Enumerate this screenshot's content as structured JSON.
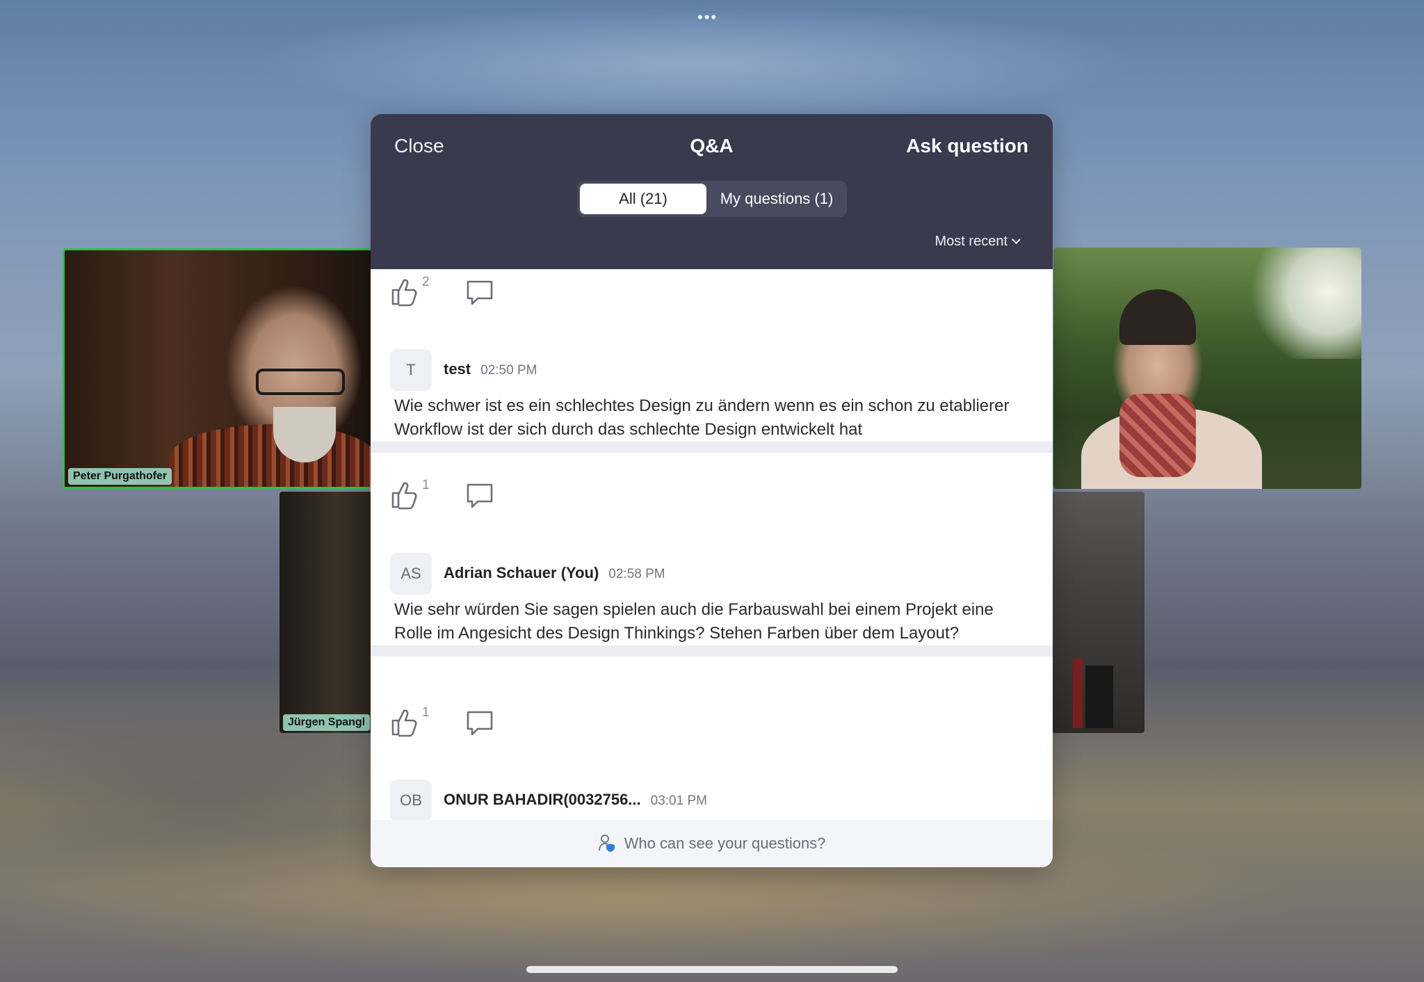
{
  "window": {
    "more_icon": "ellipsis-icon"
  },
  "participants": [
    {
      "name": "Peter Purgathofer",
      "speaking": true,
      "speaking_color": "#2fbf4a"
    },
    {
      "name": "Jürgen Spangl"
    }
  ],
  "qa": {
    "close_label": "Close",
    "title": "Q&A",
    "ask_label": "Ask question",
    "tabs": [
      {
        "label": "All (21)",
        "selected": true
      },
      {
        "label": "My questions (1)",
        "selected": false
      }
    ],
    "sort_label": "Most recent",
    "header_color": "#3a3a4e",
    "questions": [
      {
        "likes": "2"
      },
      {
        "initials": "T",
        "author": "test",
        "time": "02:50 PM",
        "text": "Wie schwer ist es ein schlechtes Design zu ändern wenn es ein schon zu etablierer Workflow ist der sich durch das schlechte Design entwickelt hat",
        "likes": "1"
      },
      {
        "initials": "AS",
        "author": "Adrian Schauer (You)",
        "time": "02:58 PM",
        "text": "Wie sehr würden Sie sagen spielen auch die Farbauswahl bei einem Projekt eine Rolle im Angesicht des Design Thinkings? Stehen Farben über dem Layout?",
        "likes": "1"
      },
      {
        "initials": "OB",
        "author": "ONUR BAHADIR(0032756...",
        "time": "03:01 PM"
      }
    ],
    "footer_label": "Who can see your questions?"
  }
}
